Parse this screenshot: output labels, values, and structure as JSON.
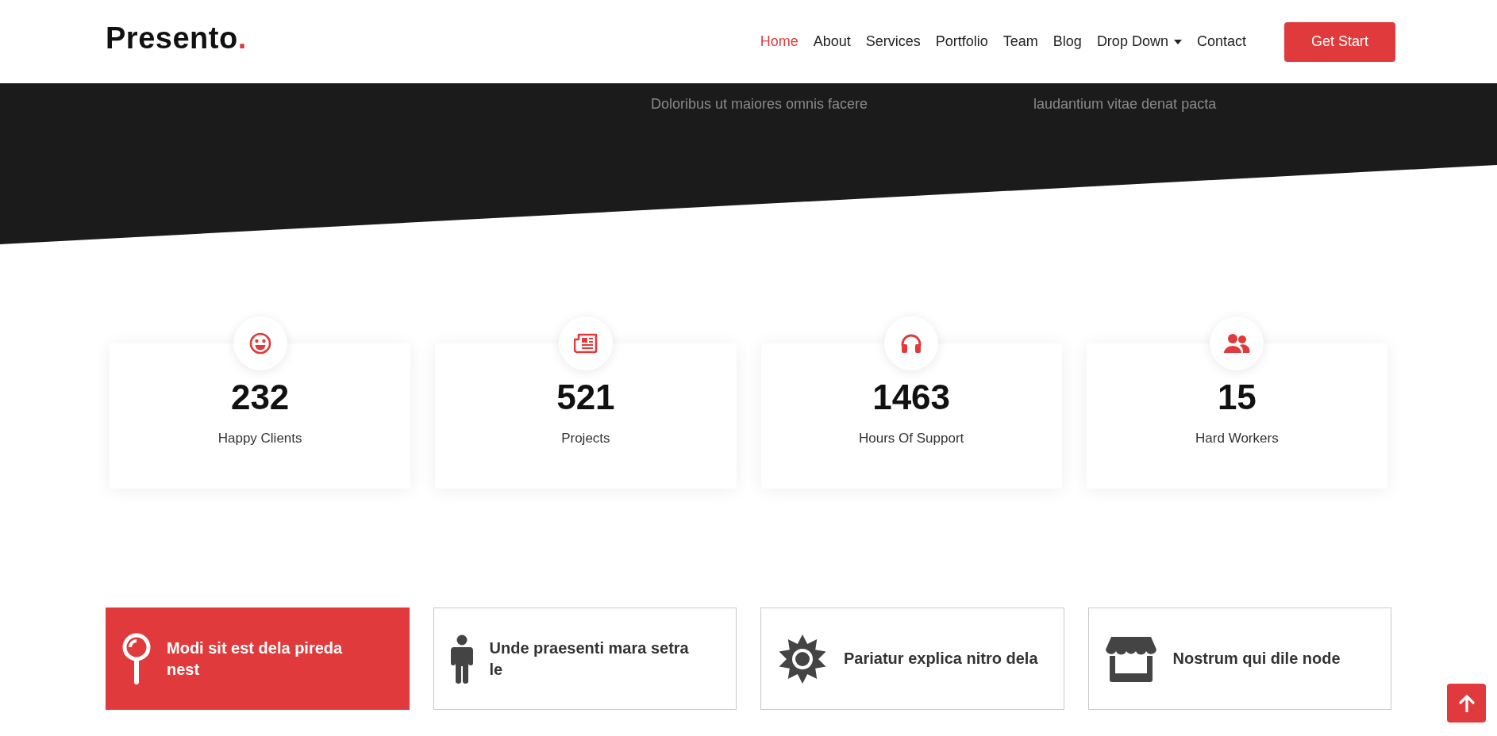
{
  "header": {
    "logo": "Presento",
    "logo_dot": ".",
    "nav": [
      {
        "label": "Home",
        "selected": true
      },
      {
        "label": "About",
        "selected": false
      },
      {
        "label": "Services",
        "selected": false
      },
      {
        "label": "Portfolio",
        "selected": false
      },
      {
        "label": "Team",
        "selected": false
      },
      {
        "label": "Blog",
        "selected": false
      },
      {
        "label": "Drop Down",
        "selected": false,
        "dropdown": true
      },
      {
        "label": "Contact",
        "selected": false
      }
    ],
    "cta": "Get Start"
  },
  "hero_tail": {
    "lines": [
      "Doloribus ut maiores omnis facere",
      "laudantium vitae denat pacta"
    ]
  },
  "stats": [
    {
      "kind": "smile",
      "value": "232",
      "label": "Happy Clients"
    },
    {
      "kind": "newspaper",
      "value": "521",
      "label": "Projects"
    },
    {
      "kind": "headset",
      "value": "1463",
      "label": "Hours Of Support"
    },
    {
      "kind": "users",
      "value": "15",
      "label": "Hard Workers"
    }
  ],
  "features": [
    {
      "kind": "pin",
      "title": "Modi sit est dela pireda nest",
      "selected": true
    },
    {
      "kind": "person",
      "title": "Unde praesenti mara setra le",
      "selected": false
    },
    {
      "kind": "seal",
      "title": "Pariatur explica nitro dela",
      "selected": false
    },
    {
      "kind": "store",
      "title": "Nostrum qui dile node",
      "selected": false
    }
  ]
}
